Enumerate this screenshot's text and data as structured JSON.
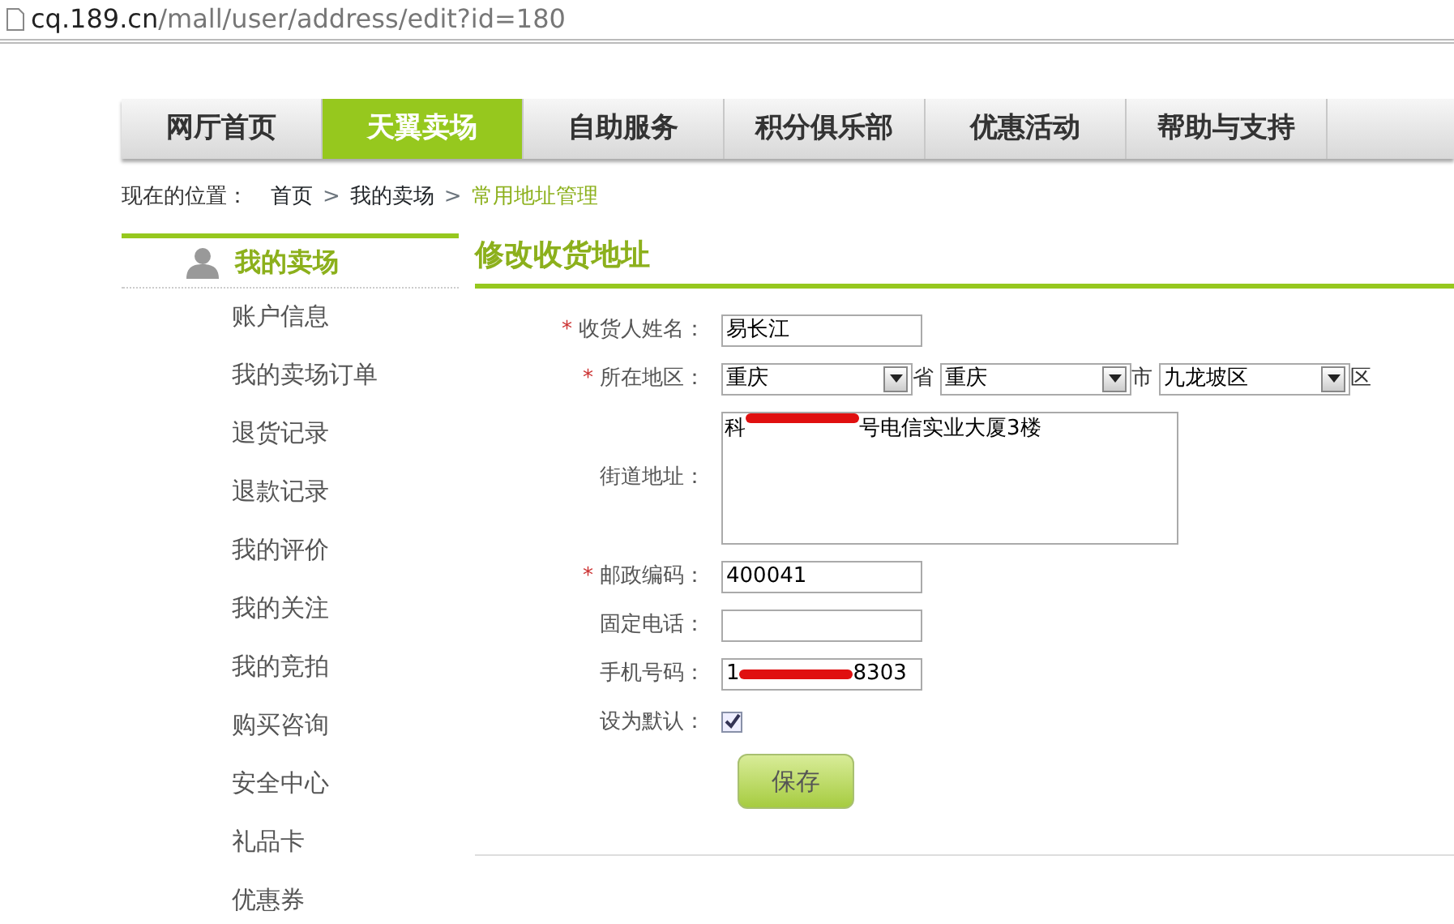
{
  "address_bar": {
    "host": "cq.189.cn",
    "path": "/mall/user/address/edit?id=180"
  },
  "nav_tabs": [
    {
      "label": "网厅首页",
      "selected": false
    },
    {
      "label": "天翼卖场",
      "selected": true
    },
    {
      "label": "自助服务",
      "selected": false
    },
    {
      "label": "积分俱乐部",
      "selected": false
    },
    {
      "label": "优惠活动",
      "selected": false
    },
    {
      "label": "帮助与支持",
      "selected": false
    }
  ],
  "breadcrumb": {
    "label": "现在的位置：",
    "items": [
      {
        "text": "首页",
        "current": false
      },
      {
        "text": "我的卖场",
        "current": false
      },
      {
        "text": "常用地址管理",
        "current": true
      }
    ],
    "separator": ">"
  },
  "sidebar": {
    "title": "我的卖场",
    "items": [
      "账户信息",
      "我的卖场订单",
      "退货记录",
      "退款记录",
      "我的评价",
      "我的关注",
      "我的竞拍",
      "购买咨询",
      "安全中心",
      "礼品卡",
      "优惠券"
    ]
  },
  "page_title": "修改收货地址",
  "form": [
    {
      "kind": "text",
      "label": "收货人姓名：",
      "required_mark": "*",
      "value": "易长江"
    },
    {
      "kind": "region",
      "label": "所在地区：",
      "required_mark": "*",
      "selects": [
        {
          "value": "重庆",
          "suffix": "省"
        },
        {
          "value": "重庆",
          "suffix": "市"
        },
        {
          "value": "九龙坡区",
          "suffix": "区"
        }
      ]
    },
    {
      "kind": "textarea",
      "label": "街道地址：",
      "value_before": "科",
      "value_after": "号电信实业大厦3楼",
      "redacted": true
    },
    {
      "kind": "text",
      "label": "邮政编码：",
      "required_mark": "*",
      "value": "400041"
    },
    {
      "kind": "text",
      "label": "固定电话："
    },
    {
      "kind": "text",
      "label": "手机号码：",
      "value_before": "1",
      "value_after": "8303",
      "redacted": true
    },
    {
      "kind": "checkbox",
      "label": "设为默认：",
      "checked": true
    }
  ],
  "save_button": "保存"
}
